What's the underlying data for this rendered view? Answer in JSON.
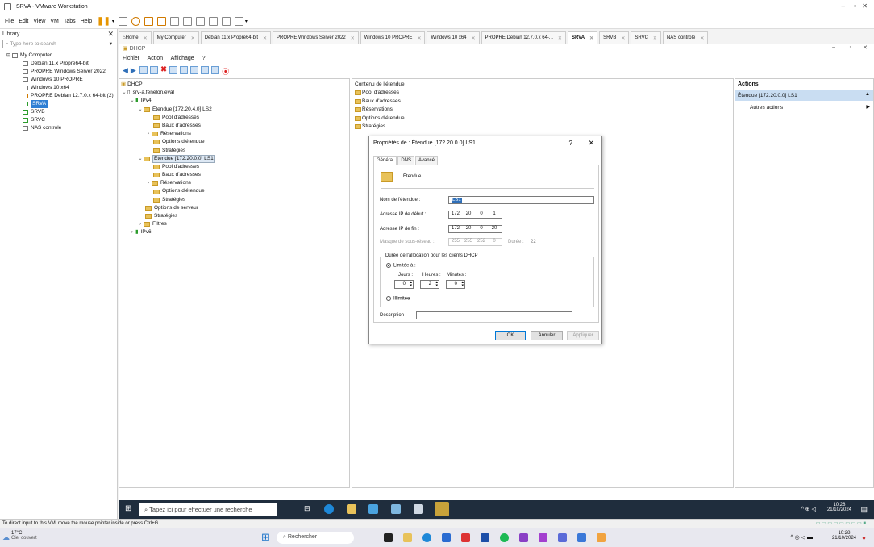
{
  "window": {
    "title": "SRVA - VMware Workstation"
  },
  "menu": {
    "items": [
      "File",
      "Edit",
      "View",
      "VM",
      "Tabs",
      "Help"
    ]
  },
  "library": {
    "title": "Library",
    "search_placeholder": "Type here to search",
    "root": "My Computer",
    "items": [
      "Debian 11.x Propre64-bit",
      "PROPRE Windows Server 2022",
      "Windows 10 PROPRE",
      "Windows 10 x64",
      "PROPRE Debian 12.7.0.x 64-bit (2)",
      "SRVA",
      "SRVB",
      "SRVC",
      "NAS controle"
    ]
  },
  "tabs": [
    "Home",
    "My Computer",
    "Debian 11.x Propre64-bit",
    "PROPRE Windows Server 2022",
    "Windows 10 PROPRE",
    "Windows 10 x64",
    "PROPRE Debian 12.7.0.x 64-...",
    "SRVA",
    "SRVB",
    "SRVC",
    "NAS controle"
  ],
  "mmc": {
    "title": "DHCP",
    "menu": [
      "Fichier",
      "Action",
      "Affichage",
      "?"
    ],
    "tree": {
      "root": "DHCP",
      "server": "srv-a.fenelon.eval",
      "ipv4": "IPv4",
      "scope1": "Étendue [172.20.4.0] LS2",
      "scope1_children": [
        "Pool d'adresses",
        "Baux d'adresses",
        "Réservations",
        "Options d'étendue",
        "Stratégies"
      ],
      "scope2": "Étendue [172.20.0.0] LS1",
      "scope2_children": [
        "Pool d'adresses",
        "Baux d'adresses",
        "Réservations",
        "Options d'étendue",
        "Stratégies"
      ],
      "server_options": "Options de serveur",
      "policies": "Stratégies",
      "filters": "Filtres",
      "ipv6": "IPv6"
    },
    "content": {
      "header": "Contenu de l'étendue",
      "items": [
        "Pool d'adresses",
        "Baux d'adresses",
        "Réservations",
        "Options d'étendue",
        "Stratégies"
      ]
    },
    "actions": {
      "header": "Actions",
      "selected": "Étendue [172.20.0.0] LS1",
      "more": "Autres actions"
    }
  },
  "dialog": {
    "title": "Propriétés de : Étendue [172.20.0.0] LS1",
    "help": "?",
    "close": "✕",
    "tabs": [
      "Général",
      "DNS",
      "Avancé"
    ],
    "section_title": "Étendue",
    "scope_name_label": "Nom de l'étendue :",
    "scope_name_value": "LS1",
    "start_ip_label": "Adresse IP de début :",
    "start_ip": [
      "172",
      "20",
      "0",
      "1"
    ],
    "end_ip_label": "Adresse IP de fin :",
    "end_ip": [
      "172",
      "20",
      "0",
      "20"
    ],
    "mask_label": "Masque de sous-réseau :",
    "mask": [
      "255",
      "255",
      "252",
      "0"
    ],
    "length_label": "Durée :",
    "length_value": "22",
    "lease_group": "Durée de l'allocation pour les clients DHCP",
    "limited_label": "Limitée à :",
    "days_label": "Jours :",
    "days": "0",
    "hours_label": "Heures :",
    "hours": "2",
    "minutes_label": "Minutes :",
    "minutes": "0",
    "unlimited_label": "Illimitée",
    "description_label": "Description :",
    "description_value": "",
    "ok": "OK",
    "cancel": "Annuler",
    "apply": "Appliquer"
  },
  "guest_taskbar": {
    "search": "Tapez ici pour effectuer une recherche",
    "time": "10:28",
    "date": "21/10/2024"
  },
  "vm_status": "To direct input to this VM, move the mouse pointer inside or press Ctrl+G.",
  "host_taskbar": {
    "temp": "17°C",
    "weather": "Ciel couvert",
    "search": "Rechercher",
    "time": "10:28",
    "date": "21/10/2024"
  }
}
